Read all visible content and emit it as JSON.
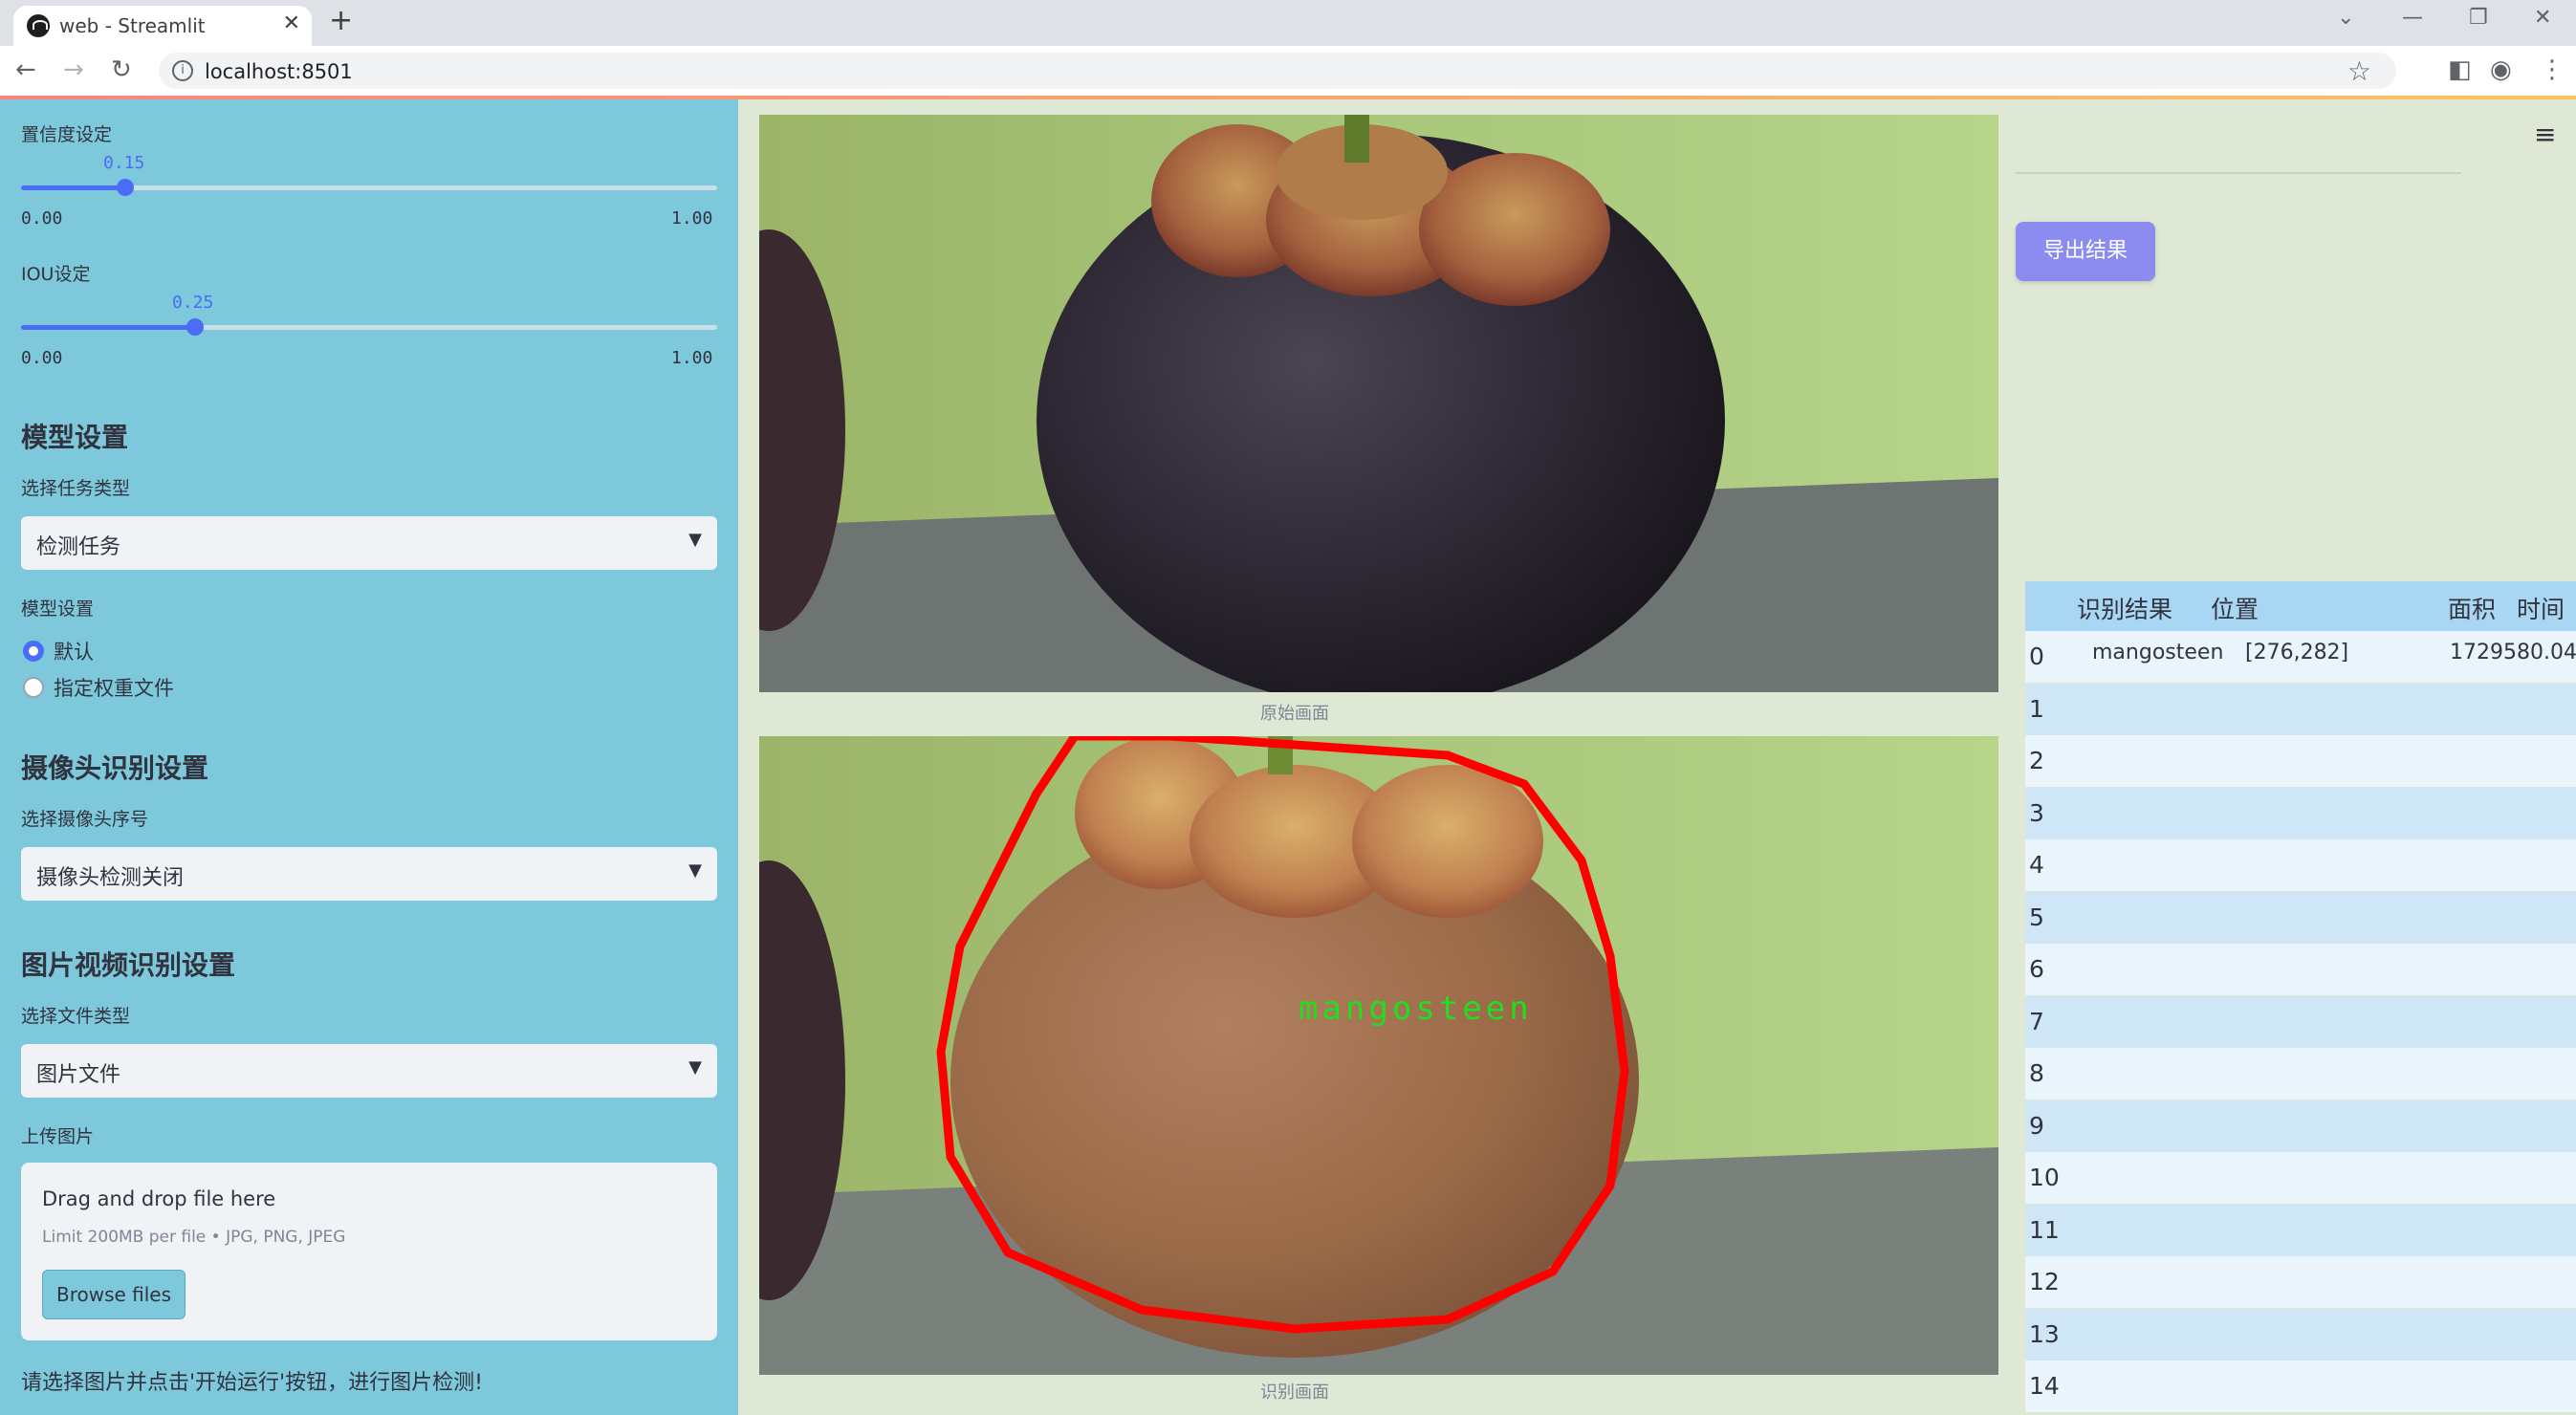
{
  "browser": {
    "tab_title": "web - Streamlit",
    "url": "localhost:8501"
  },
  "sidebar": {
    "confidence": {
      "label": "置信度设定",
      "value": "0.15",
      "value_num": 0.15,
      "min": "0.00",
      "max": "1.00"
    },
    "iou": {
      "label": "IOU设定",
      "value": "0.25",
      "value_num": 0.25,
      "min": "0.00",
      "max": "1.00"
    },
    "model_section": {
      "title": "模型设置",
      "task_label": "选择任务类型",
      "task_value": "检测任务",
      "weights_label": "模型设置",
      "radio_options": [
        "默认",
        "指定权重文件"
      ],
      "radio_selected": "默认"
    },
    "camera_section": {
      "title": "摄像头识别设置",
      "camera_label": "选择摄像头序号",
      "camera_value": "摄像头检测关闭"
    },
    "file_section": {
      "title": "图片视频识别设置",
      "type_label": "选择文件类型",
      "type_value": "图片文件",
      "upload_label": "上传图片",
      "drop_title": "Drag and drop file here",
      "drop_limit": "Limit 200MB per file • JPG, PNG, JPEG",
      "browse_label": "Browse files"
    },
    "hint": "请选择图片并点击'开始运行'按钮，进行图片检测!"
  },
  "main": {
    "original_caption": "原始画面",
    "result_caption": "识别画面",
    "detection_label": "mangosteen",
    "export_label": "导出结果"
  },
  "table": {
    "headers": [
      "识别结果",
      "位置",
      "面积",
      "时间"
    ],
    "rows": [
      {
        "index": "0",
        "result": "mangosteen",
        "position": "[276,282]",
        "area": "1729580.04"
      },
      {
        "index": "1"
      },
      {
        "index": "2"
      },
      {
        "index": "3"
      },
      {
        "index": "4"
      },
      {
        "index": "5"
      },
      {
        "index": "6"
      },
      {
        "index": "7"
      },
      {
        "index": "8"
      },
      {
        "index": "9"
      },
      {
        "index": "10"
      },
      {
        "index": "11"
      },
      {
        "index": "12"
      },
      {
        "index": "13"
      },
      {
        "index": "14"
      }
    ]
  },
  "colors": {
    "sidebar_bg": "#7ec8dc",
    "accent": "#4a6cf7",
    "export_button": "#8b8bf0",
    "detection_outline": "#ff0000",
    "detection_label": "#22dd22"
  }
}
